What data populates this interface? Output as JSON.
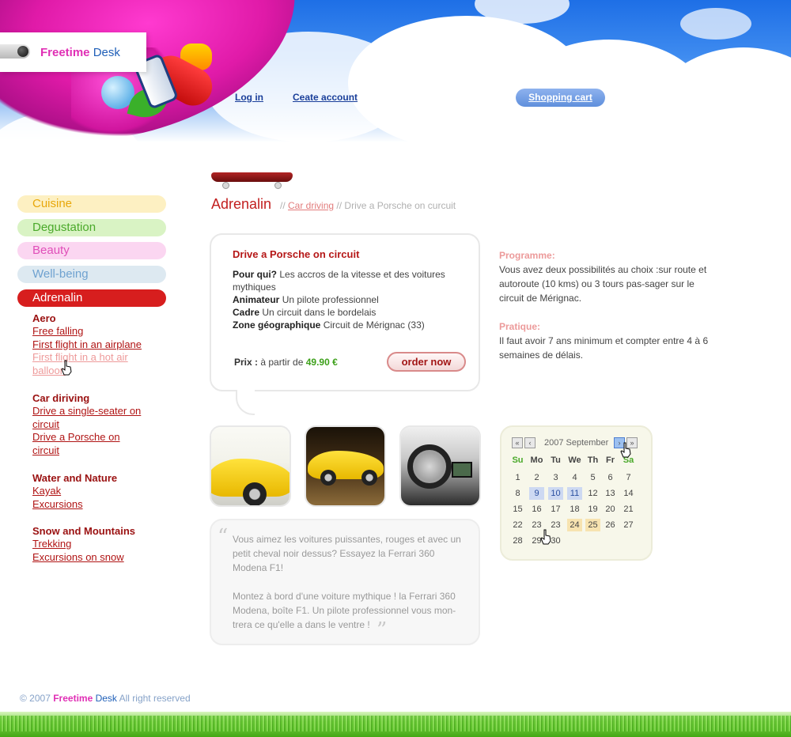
{
  "logo": {
    "part1": "Freetime",
    "part2": "Desk"
  },
  "header": {
    "login": "Log in",
    "create_account": "Ceate account",
    "cart": "Shopping cart"
  },
  "sidebar": {
    "categories": [
      {
        "label": "Cuisine",
        "color": "#fdf0c2",
        "text_color": "#e8a70a"
      },
      {
        "label": "Degustation",
        "color": "#d9f3c4",
        "text_color": "#4aa92a"
      },
      {
        "label": "Beauty",
        "color": "#fbd6f1",
        "text_color": "#e04fb9"
      },
      {
        "label": "Well-being",
        "color": "#dde9f1",
        "text_color": "#6fa2d0"
      },
      {
        "label": "Adrenalin",
        "color": "#d71e1e",
        "text_color": "#ffffff"
      }
    ],
    "groups": [
      {
        "title": "Aero",
        "links": [
          "Free falling",
          "First flight in an airplane",
          "First flight in a hot air balloon"
        ]
      },
      {
        "title": "Car diriving",
        "links": [
          "Drive a single-seater on circuit",
          "Drive a Porsche on circuit"
        ]
      },
      {
        "title": "Water and Nature",
        "links": [
          "Kayak",
          "Excursions"
        ]
      },
      {
        "title": "Snow and Mountains",
        "links": [
          "Trekking",
          "Excursions on snow"
        ]
      }
    ]
  },
  "breadcrumb": {
    "title": "Adrenalin",
    "sep": "//",
    "link": "Car driving",
    "current": "Drive a Porsche on curcuit"
  },
  "offer": {
    "title": "Drive a Porsche on circuit",
    "rows": [
      {
        "label": "Pour qui?",
        "text": "Les accros de la vitesse et des voitures mythiques"
      },
      {
        "label": "Animateur",
        "text": "Un pilote professionnel"
      },
      {
        "label": "Cadre",
        "text": "Un circuit dans le bordelais"
      },
      {
        "label": "Zone géographique",
        "text": "Circuit de Mérignac (33)"
      }
    ],
    "price_label": "Prix :",
    "price_prefix": "à partir de",
    "price_value": "49.90 €",
    "order_button": "order now"
  },
  "info": {
    "programme_title": "Programme:",
    "programme_text": "Vous avez deux possibilités au choix :sur route et autoroute (10 kms) ou 3 tours pas-sager sur le circuit de Mérignac.",
    "pratique_title": "Pratique:",
    "pratique_text": "Il faut avoir 7 ans minimum et compter entre 4 à 6 semaines de délais."
  },
  "quote": {
    "p1": "Vous aimez les voitures puissantes, rouges et avec un petit cheval noir dessus? Essayez la Ferrari 360 Modena F1!",
    "p2": "Montez à bord d'une voiture mythique ! la Ferrari 360 Modena, boîte F1. Un pilote professionnel vous mon-trera ce qu'elle a dans le ventre !"
  },
  "calendar": {
    "month_label": "2007 September",
    "prev_year": "«",
    "prev_month": "‹",
    "next_month": "›",
    "next_year": "»",
    "weekdays": [
      "Su",
      "Mo",
      "Tu",
      "We",
      "Th",
      "Fr",
      "Sa"
    ],
    "weeks": [
      [
        "1",
        "2",
        "3",
        "4",
        "5",
        "6",
        "7"
      ],
      [
        "8",
        "9",
        "10",
        "11",
        "12",
        "13",
        "14"
      ],
      [
        "15",
        "16",
        "17",
        "18",
        "19",
        "20",
        "21"
      ],
      [
        "22",
        "23",
        "23",
        "24",
        "25",
        "26",
        "27"
      ],
      [
        "28",
        "29",
        "30",
        "",
        "",
        "",
        ""
      ]
    ],
    "highlight_blue": [
      "9",
      "10",
      "11"
    ],
    "highlight_orange": [
      "24",
      "25"
    ]
  },
  "footer": {
    "year": "© 2007",
    "brand1": "Freetime",
    "brand2": "Desk",
    "rights": "All right reserved"
  }
}
